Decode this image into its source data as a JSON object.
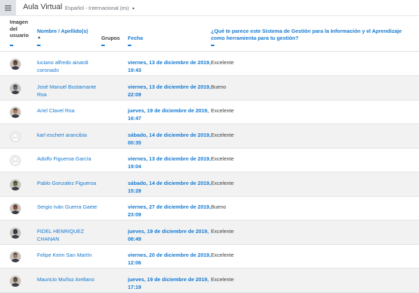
{
  "topbar": {
    "site_title": "Aula Virtual",
    "language": "Español - Internacional (es)"
  },
  "columns": {
    "imagen": [
      "Imagen",
      "del",
      "usuario"
    ],
    "nombre": "Nombre / Apellido(s)",
    "grupos": "Grupos",
    "fecha": "Fecha",
    "pregunta": "¿Qué te parece este Sistema de Gestión para la Información y el Aprendizaje como herramienta para tu gestión?"
  },
  "rows": [
    {
      "name": "luciano alfredo ainardi coronado",
      "date": "viernes, 13 de diciembre de 2019, 19:43",
      "answer": "Excelente",
      "avatar": "photo"
    },
    {
      "name": "José Manuel Bustamante Roa",
      "date": "viernes, 13 de diciembre de 2019, 22:09",
      "answer": "Bueno",
      "avatar": "photo"
    },
    {
      "name": "Ariel Clavel Roa",
      "date": "jueves, 19 de diciembre de 2019, 16:47",
      "answer": "Excelente",
      "avatar": "photo"
    },
    {
      "name": "karl eschert arancibia",
      "date": "sábado, 14 de diciembre de 2019, 00:35",
      "answer": "Excelente",
      "avatar": "default"
    },
    {
      "name": "Adolfo Figueroa García",
      "date": "viernes, 13 de diciembre de 2019, 19:04",
      "answer": "Excelente",
      "avatar": "default"
    },
    {
      "name": "Pablo Gonzalez Figueroa",
      "date": "sábado, 14 de diciembre de 2019, 15:28",
      "answer": "Excelente",
      "avatar": "photo"
    },
    {
      "name": "Sergio Iván Guerra Gaete",
      "date": "viernes, 27 de diciembre de 2019, 23:09",
      "answer": "Bueno",
      "avatar": "photo"
    },
    {
      "name": "FIDEL HENRIQUEZ CHANAN",
      "date": "jueves, 19 de diciembre de 2019, 08:49",
      "answer": "Excelente",
      "avatar": "photo"
    },
    {
      "name": "Felipe Keim San Martín",
      "date": "viernes, 20 de diciembre de 2019, 12:06",
      "answer": "Excelente",
      "avatar": "photo"
    },
    {
      "name": "Mauricio Muñoz Arellano",
      "date": "jueves, 19 de diciembre de 2019, 17:19",
      "answer": "Excelente",
      "avatar": "photo"
    }
  ],
  "colors": {
    "link": "#1177d1",
    "alt_row": "#f2f2f2",
    "text": "#373a3c"
  }
}
